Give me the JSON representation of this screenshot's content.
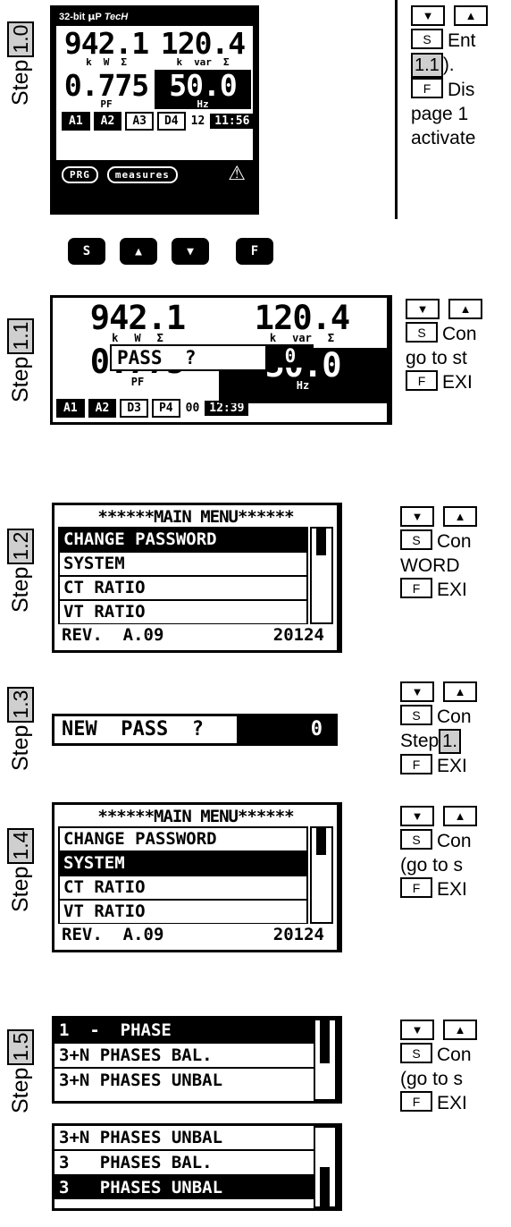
{
  "steps": [
    {
      "id": "step-1-0",
      "label_word": "Step",
      "label_num": "1.0",
      "instructions": {
        "keys_row": [
          "down-arrow",
          "up-arrow"
        ],
        "lines": [
          {
            "key": "S",
            "text": "Ent"
          },
          {
            "ref": "1.1",
            "text": ")."
          },
          {
            "key": "F",
            "text": "Dis"
          },
          {
            "text": "page 1"
          },
          {
            "text": "activate"
          }
        ]
      }
    },
    {
      "id": "step-1-1",
      "label_word": "Step",
      "label_num": "1.1",
      "instructions": {
        "keys_row": [
          "down-arrow",
          "up-arrow"
        ],
        "lines": [
          {
            "key": "S",
            "text": "Con"
          },
          {
            "text": "go to st"
          },
          {
            "key": "F",
            "text": "EXI"
          }
        ]
      }
    },
    {
      "id": "step-1-2",
      "label_word": "Step",
      "label_num": "1.2",
      "instructions": {
        "keys_row": [
          "down-arrow",
          "up-arrow"
        ],
        "lines": [
          {
            "key": "S",
            "text": "Con"
          },
          {
            "text": "WORD"
          },
          {
            "key": "F",
            "text": "EXI"
          }
        ]
      }
    },
    {
      "id": "step-1-3",
      "label_word": "Step",
      "label_num": "1.3",
      "instructions": {
        "keys_row": [
          "down-arrow",
          "up-arrow"
        ],
        "lines": [
          {
            "key": "S",
            "text": "Con"
          },
          {
            "text": "Step ",
            "ref": "1."
          },
          {
            "key": "F",
            "text": "EXI"
          }
        ]
      }
    },
    {
      "id": "step-1-4",
      "label_word": "Step",
      "label_num": "1.4",
      "instructions": {
        "keys_row": [
          "down-arrow",
          "up-arrow"
        ],
        "lines": [
          {
            "key": "S",
            "text": "Con"
          },
          {
            "text": "(go to s"
          },
          {
            "key": "F",
            "text": "EXI"
          }
        ]
      }
    },
    {
      "id": "step-1-5",
      "label_word": "Step",
      "label_num": "1.5",
      "instructions": {
        "keys_row": [
          "down-arrow",
          "up-arrow"
        ],
        "lines": [
          {
            "key": "S",
            "text": "Con"
          },
          {
            "text": "(go to s"
          },
          {
            "key": "F",
            "text": "EXI"
          }
        ]
      }
    }
  ],
  "meter": {
    "brand_prefix": "32-bit ",
    "brand_mu": "μ",
    "brand_mid": "P ",
    "brand_model": "TecH",
    "readings": {
      "power_value": "942.1",
      "power_units": [
        "k",
        "W",
        "Σ"
      ],
      "reactive_value": "120.4",
      "reactive_units": [
        "k",
        "var",
        "Σ"
      ],
      "pf_value": "0.775",
      "pf_unit": "PF",
      "freq_value": "50.0",
      "freq_unit": "Hz"
    },
    "status_tags": [
      {
        "text": "A1",
        "state": "on"
      },
      {
        "text": "A2",
        "state": "on"
      },
      {
        "text": "A3",
        "state": "off"
      },
      {
        "text": "D4",
        "state": "off"
      },
      {
        "text": "12",
        "state": "plain"
      },
      {
        "text": "11:56",
        "state": "clock"
      }
    ],
    "footer": {
      "prg_label": "PRG",
      "measures_label": "measures",
      "warning_icon": "warning-triangle"
    }
  },
  "keypad": {
    "keys": [
      {
        "name": "s-key",
        "label": "S"
      },
      {
        "name": "up-key",
        "label": "▲"
      },
      {
        "name": "down-key",
        "label": "▼"
      },
      {
        "name": "f-key",
        "label": "F"
      }
    ]
  },
  "display_1_1": {
    "power_value": "942.1",
    "power_units": [
      "k",
      "W",
      "Σ"
    ],
    "reactive_value": "120.4",
    "reactive_units": [
      "k",
      "var",
      "Σ"
    ],
    "pf_value": "0.775",
    "pf_unit": "PF",
    "freq_value": "50.0",
    "freq_unit": "Hz",
    "popup_label": "PASS  ?",
    "popup_value": "0",
    "status_tags": [
      {
        "text": "A1",
        "state": "on"
      },
      {
        "text": "A2",
        "state": "on"
      },
      {
        "text": "D3",
        "state": "off"
      },
      {
        "text": "P4",
        "state": "off"
      },
      {
        "text": "00",
        "state": "plain"
      },
      {
        "text": "12:39",
        "state": "clock"
      }
    ]
  },
  "main_menu_1_2": {
    "title": "******MAIN MENU******",
    "items": [
      {
        "label": "CHANGE PASSWORD",
        "selected": true
      },
      {
        "label": "SYSTEM",
        "selected": false
      },
      {
        "label": "CT RATIO",
        "selected": false
      },
      {
        "label": "VT RATIO",
        "selected": false
      }
    ],
    "footer_left": "REV.  A.09",
    "footer_right": "20124"
  },
  "new_pass_1_3": {
    "label": "NEW  PASS  ?",
    "value": "0"
  },
  "main_menu_1_4": {
    "title": "******MAIN MENU******",
    "items": [
      {
        "label": "CHANGE PASSWORD",
        "selected": false
      },
      {
        "label": "SYSTEM",
        "selected": true
      },
      {
        "label": "CT RATIO",
        "selected": false
      },
      {
        "label": "VT RATIO",
        "selected": false
      }
    ],
    "footer_left": "REV.  A.09",
    "footer_right": "20124"
  },
  "phase_list_top": {
    "items": [
      {
        "label": "1  -  PHASE",
        "selected": true
      },
      {
        "label": "3+N PHASES BAL.",
        "selected": false
      },
      {
        "label": "3+N PHASES UNBAL",
        "selected": false
      }
    ]
  },
  "phase_list_bottom": {
    "items": [
      {
        "label": "3+N PHASES UNBAL",
        "selected": false
      },
      {
        "label": "3   PHASES BAL.",
        "selected": false
      },
      {
        "label": "3   PHASES UNBAL",
        "selected": true
      }
    ]
  }
}
